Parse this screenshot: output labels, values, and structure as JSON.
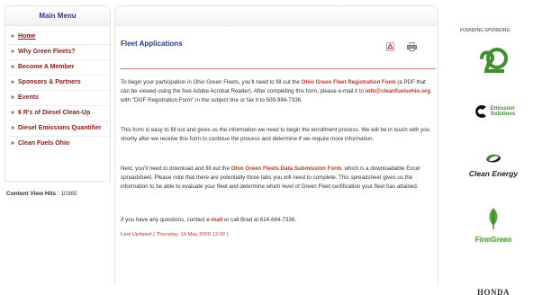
{
  "menu": {
    "title": "Main Menu",
    "items": [
      {
        "label": "Home"
      },
      {
        "label": "Why Green Fleets?"
      },
      {
        "label": "Become A Member"
      },
      {
        "label": "Sponsors & Partners"
      },
      {
        "label": "Events"
      },
      {
        "label": "6 R's of Diesel Clean-Up"
      },
      {
        "label": "Diesel Emissions Quantifier"
      },
      {
        "label": "Clean Fuels Ohio"
      }
    ]
  },
  "hits": {
    "label": "Content View Hits",
    "value": "10365"
  },
  "article": {
    "title": "Fleet Applications",
    "p1": {
      "a": "To begin your participation in Ohio Green Fleets, you'll need to fill out the ",
      "link1": "Ohio Green Fleet Registration Form",
      "b": " (a PDF that can be viewed using the free Adobe Acrobat Reader). After completing this form, please e-mail it to ",
      "link2": "info@cleanfuelsohio.org",
      "c": " with \"OGF Registration Form\" in the subject line or fax it to 509-984-7336."
    },
    "p2": "This form is easy to fill out and gives us the information we need to begin the enrollment process. We will be in touch with you shortly after we receive this form to continue the process and determine if we require more information.",
    "p3": {
      "a": "Next, you'll need to download and fill out the ",
      "link": "Ohio Green Fleets Data Submission Form",
      "b": ", which is a downloadable Excel spreadsheet. Please note that there are potentially three tabs you will need to complete. This spreadsheet gives us the information to be able to evaluate your fleet and determine which level of Green Fleet certification your fleet has attained."
    },
    "p4": {
      "a": "If you have any questions, contact ",
      "link": "e-mail",
      "b": " or call Brad at 614-884-7336."
    },
    "updated": "Last Updated ( Thursday, 14 May 2009 12:02 )"
  },
  "sponsors": {
    "label": "FOUNDING SPONSORS:",
    "emission_line1": "Emission",
    "emission_line2": "Solutions",
    "clean_energy": "Clean Energy",
    "firmgreen": "FirmGreen",
    "honda": "HONDA"
  },
  "colors": {
    "link": "#c0392b",
    "heading": "#2a3a8c",
    "menu_link": "#8b1a1a",
    "green": "#3f8f2f"
  }
}
